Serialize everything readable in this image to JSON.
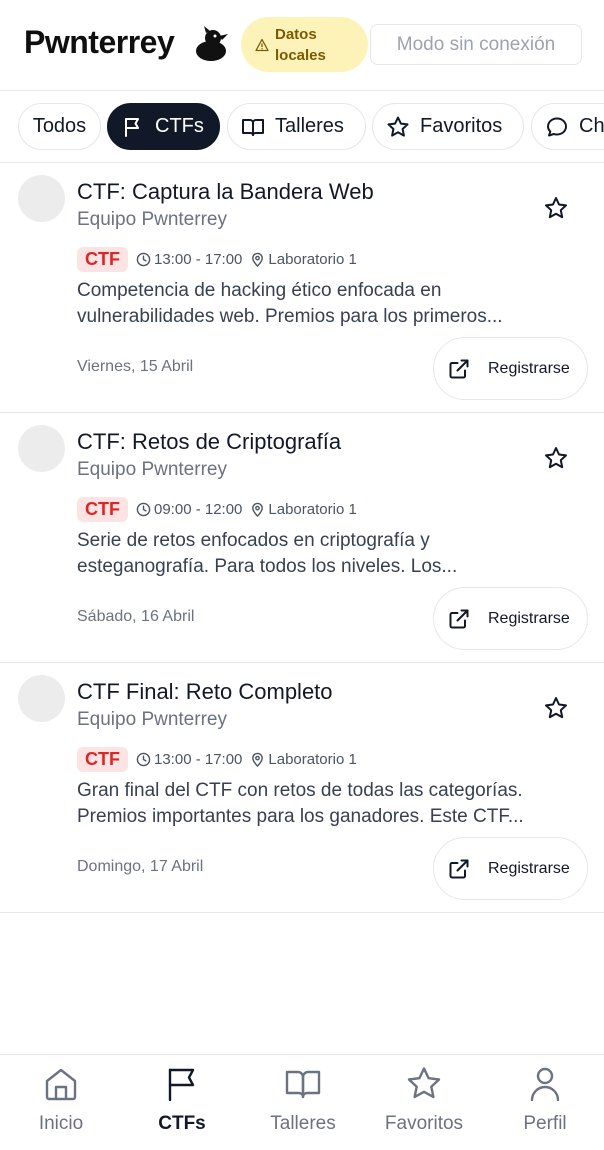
{
  "header": {
    "app_title": "Pwnterrey",
    "logo_icon": "duck-logo-icon",
    "local_badge": "Datos locales",
    "offline_button": "Modo sin conexión"
  },
  "filters": [
    {
      "label": "Todos",
      "icon": "",
      "active": false
    },
    {
      "label": "CTFs",
      "icon": "flag-icon",
      "active": true
    },
    {
      "label": "Talleres",
      "icon": "book-icon",
      "active": false
    },
    {
      "label": "Favoritos",
      "icon": "star-icon",
      "active": false
    },
    {
      "label": "Ch",
      "icon": "chat-icon",
      "active": false
    }
  ],
  "events": [
    {
      "title": "CTF: Captura la Bandera Web",
      "organizer": "Equipo Pwnterrey",
      "badge": "CTF",
      "time": "13:00 - 17:00",
      "location": "Laboratorio 1",
      "description_line1": "Competencia de hacking ético enfocada en",
      "description_line2": "vulnerabilidades web. Premios para los primeros...",
      "date": "Viernes, 15 Abril",
      "register_label": "Registrarse"
    },
    {
      "title": "CTF: Retos de Criptografía",
      "organizer": "Equipo Pwnterrey",
      "badge": "CTF",
      "time": "09:00 - 12:00",
      "location": "Laboratorio 1",
      "description_line1": "Serie de retos enfocados en criptografía y",
      "description_line2": "esteganografía. Para todos los niveles. Los...",
      "date": "Sábado, 16 Abril",
      "register_label": "Registrarse"
    },
    {
      "title": "CTF Final: Reto Completo",
      "organizer": "Equipo Pwnterrey",
      "badge": "CTF",
      "time": "13:00 - 17:00",
      "location": "Laboratorio 1",
      "description_line1": "Gran final del CTF con retos de todas las categorías.",
      "description_line2": "Premios importantes para los ganadores. Este CTF...",
      "date": "Domingo, 17 Abril",
      "register_label": "Registrarse"
    }
  ],
  "bottom_nav": [
    {
      "label": "Inicio",
      "icon": "home-icon",
      "active": false
    },
    {
      "label": "CTFs",
      "icon": "flag-icon",
      "active": true
    },
    {
      "label": "Talleres",
      "icon": "book-icon",
      "active": false
    },
    {
      "label": "Favoritos",
      "icon": "star-icon",
      "active": false
    },
    {
      "label": "Perfil",
      "icon": "user-icon",
      "active": false
    }
  ],
  "colors": {
    "primary": "#111827",
    "badge_bg": "#fde4e4",
    "badge_text": "#dc2626",
    "local_badge_bg": "#fdf3b8",
    "local_badge_text": "#7a5b04"
  }
}
